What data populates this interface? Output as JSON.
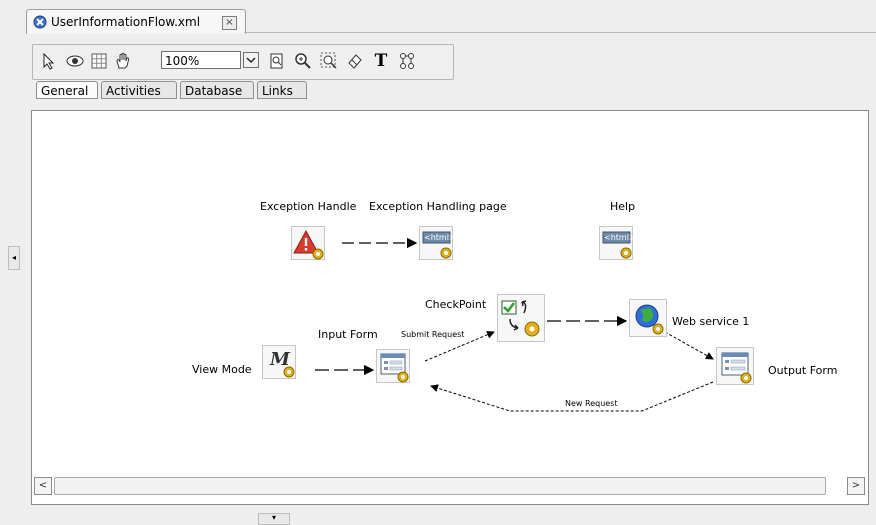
{
  "document_tab": {
    "title": "UserInformationFlow.xml",
    "close_symbol": "×",
    "icon": "flow-file-icon"
  },
  "toolbar": {
    "tools": [
      "select-pointer-icon",
      "view-eye-icon",
      "grid-icon",
      "pan-hand-icon",
      "fit-page-icon",
      "zoom-icon",
      "marquee-zoom-icon",
      "eraser-icon",
      "text-tool-icon",
      "layout-icon"
    ],
    "zoom_value": "100%",
    "text_tool_glyph": "T"
  },
  "palette_tabs": [
    {
      "label": "General",
      "active": true
    },
    {
      "label": "Activities",
      "active": false
    },
    {
      "label": "Database",
      "active": false
    },
    {
      "label": "Links",
      "active": false
    }
  ],
  "nodes": {
    "exception_handler": {
      "label": "Exception Handle",
      "icon": "warning-triangle-icon"
    },
    "exception_page": {
      "label": "Exception Handling page",
      "icon": "html-page-icon",
      "badge": "<html>"
    },
    "help": {
      "label": "Help",
      "icon": "html-page-icon",
      "badge": "<html>"
    },
    "view_mode": {
      "label": "View Mode",
      "icon": "mode-m-icon",
      "glyph": "M"
    },
    "input_form": {
      "label": "Input Form",
      "icon": "form-icon"
    },
    "checkpoint": {
      "label": "CheckPoint",
      "icon": "checkpoint-icon"
    },
    "web_service": {
      "label": "Web service 1",
      "icon": "globe-icon"
    },
    "output_form": {
      "label": "Output Form",
      "icon": "form-icon"
    }
  },
  "edges": {
    "submit_request": "Submit Request",
    "new_request": "New Request"
  },
  "scrollbar": {
    "left_arrow": "<",
    "right_arrow": ">"
  },
  "collapse": {
    "left": "◂",
    "bottom": "▾"
  },
  "colors": {
    "canvas": "#ffffff",
    "gear": "#e0b020",
    "warning": "#d83a2e",
    "html_badge": "#6f8aa8"
  }
}
